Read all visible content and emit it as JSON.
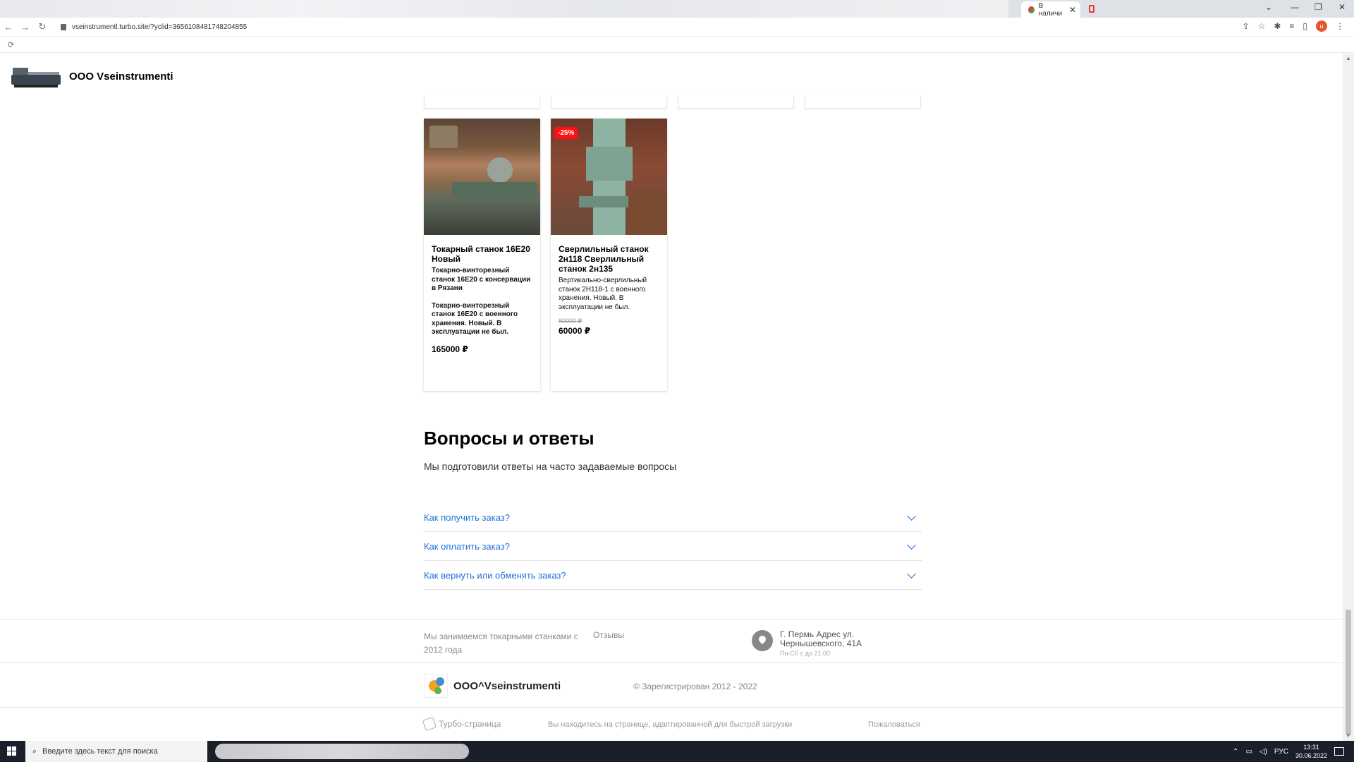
{
  "browser": {
    "tab_title": "В наличи",
    "url": "vseinstrumentl.turbo.site/?yclid=3656108481748204855",
    "avatar_letter": "u"
  },
  "site": {
    "title": "ООО Vseinstrumenti"
  },
  "products": [
    {
      "title": "Токарный станок 16Е20 Новый",
      "desc1": "Токарно-винторезный станок 16Е20 с консервации в Рязани",
      "desc2": "Токарно-винторезный станок 16Е20 с военного хранения. Новый. В эксплуатации не был.",
      "price": "165000 ₽"
    },
    {
      "badge": "-25%",
      "title": "Сверлильный станок 2н118 Сверлильный станок 2н135",
      "desc1": "Вертикально-сверлильный станок 2Н118-1 с военного хранения. Новый. В эксплуатации не был.",
      "old_price": "80000 ₽",
      "price": "60000 ₽"
    }
  ],
  "faq": {
    "heading": "Вопросы и ответы",
    "subheading": "Мы подготовили ответы на часто задаваемые вопросы",
    "items": [
      {
        "question": "Как получить заказ?"
      },
      {
        "question": "Как оплатить заказ?"
      },
      {
        "question": "Как вернуть или обменять заказ?"
      }
    ]
  },
  "footer": {
    "about": "Мы занимаемся токарными станками с 2012 года",
    "reviews": "Отзывы",
    "address": "Г. Пермь Адрес ул. Чернышевского, 41А",
    "hours": "Пн-Сб с до 21.00",
    "brand_name": "ООО^Vseinstrumenti",
    "copyright": "© Зарегистрирован 2012 - 2022",
    "turbo": "Турбо-страница",
    "fast_note": "Вы находитесь на странице, адаптированной для быстрой загрузки",
    "complain": "Пожаловаться"
  },
  "taskbar": {
    "search_placeholder": "Введите здесь текст для поиска",
    "lang": "РУС",
    "time": "13:31",
    "date": "30.06.2022"
  },
  "colors": {
    "link_blue": "#1e6fd9",
    "badge_red": "#ff1111"
  }
}
